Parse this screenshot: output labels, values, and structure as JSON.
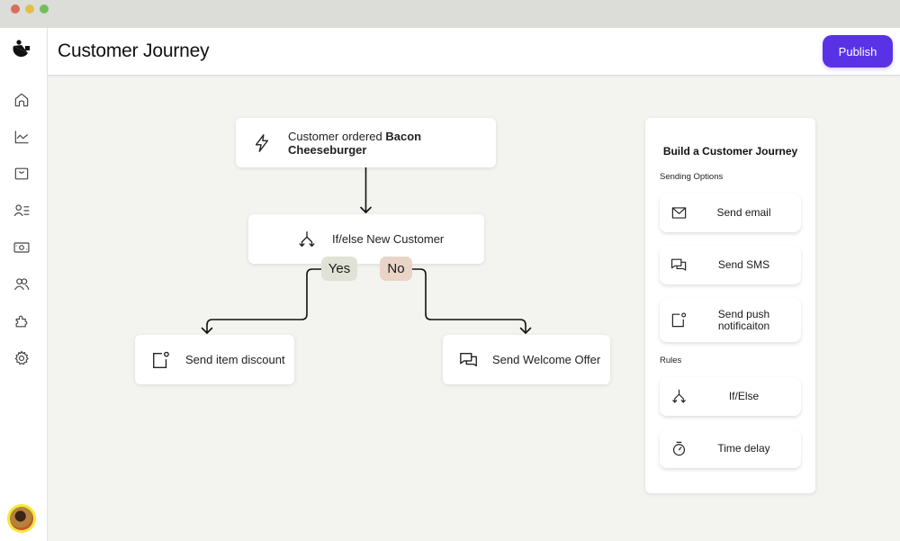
{
  "window": {
    "controls": [
      "close",
      "minimize",
      "maximize"
    ]
  },
  "sidebar": {
    "logo": "brand-logo",
    "items": [
      {
        "id": "home",
        "icon": "home-icon"
      },
      {
        "id": "analytics",
        "icon": "chart-line-icon"
      },
      {
        "id": "shop",
        "icon": "shopping-bag-icon"
      },
      {
        "id": "contacts",
        "icon": "user-list-icon"
      },
      {
        "id": "payments",
        "icon": "money-icon"
      },
      {
        "id": "audience",
        "icon": "users-icon"
      },
      {
        "id": "integrations",
        "icon": "puzzle-icon"
      },
      {
        "id": "settings",
        "icon": "gear-icon"
      }
    ],
    "avatar": "user-avatar"
  },
  "header": {
    "title": "Customer Journey",
    "publish_label": "Publish"
  },
  "flow": {
    "trigger": {
      "prefix": "Customer ordered ",
      "item": "Bacon Cheeseburger",
      "icon": "lightning-icon"
    },
    "condition": {
      "label": "If/else New Customer",
      "icon": "split-arrows-icon",
      "yes_label": "Yes",
      "no_label": "No"
    },
    "yes_action": {
      "label": "Send item discount",
      "icon": "push-notification-icon"
    },
    "no_action": {
      "label": "Send Welcome Offer",
      "icon": "chat-bubbles-icon"
    }
  },
  "panel": {
    "title": "Build a Customer Journey",
    "sending_label": "Sending Options",
    "sending_options": [
      {
        "label": "Send email",
        "icon": "envelope-icon"
      },
      {
        "label": "Send SMS",
        "icon": "chat-bubbles-icon"
      },
      {
        "label": "Send push notificaiton",
        "icon": "push-notification-icon"
      }
    ],
    "rules_label": "Rules",
    "rules": [
      {
        "label": "If/Else",
        "icon": "split-arrows-icon"
      },
      {
        "label": "Time delay",
        "icon": "stopwatch-icon"
      }
    ]
  },
  "colors": {
    "accent": "#5a32e6",
    "yes_pill": "#dfe2d4",
    "no_pill": "#ead3c7",
    "canvas_bg": "#f3f3ef"
  }
}
